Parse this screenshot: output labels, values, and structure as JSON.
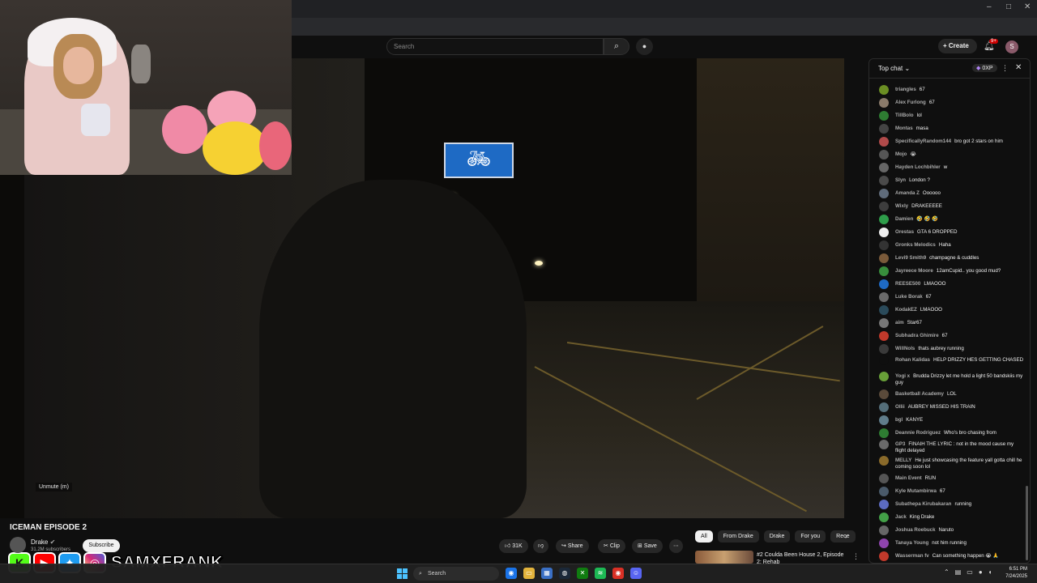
{
  "masthead": {
    "search_placeholder": "Search",
    "create_label": "Create",
    "notifications_badge": "9+",
    "profile_initial": "S"
  },
  "video": {
    "unmute_label": "Unmute (m)",
    "title": "ICEMAN EPISODE 2",
    "channel": "Drake",
    "subscribers": "31.2M subscribers",
    "subscribe_label": "Subscribe",
    "likes": "31K",
    "share_label": "Share",
    "clip_label": "Clip",
    "save_label": "Save"
  },
  "overlay": {
    "social_handle": "SAMXFRANK",
    "social_icons": [
      "kick-icon",
      "youtube-icon",
      "twitter-icon",
      "instagram-icon"
    ]
  },
  "recommendations": {
    "chips": [
      "All",
      "From Drake",
      "Drake",
      "For you",
      "Rece"
    ],
    "active_chip": "All",
    "first_title": "Coulda Been House 2, Episode 2: Rehab",
    "first_index": "#2"
  },
  "chat": {
    "mode": "Top chat",
    "xp": "0XP",
    "messages": [
      {
        "author": "triangles",
        "text": "67",
        "color": "#6b8e23"
      },
      {
        "author": "Alex Furlong",
        "text": "67",
        "color": "#8a7a6a"
      },
      {
        "author": "TillBolo",
        "text": "lol",
        "color": "#2e7d32"
      },
      {
        "author": "Montas",
        "text": "masa",
        "color": "#444444"
      },
      {
        "author": "SpecificallyRandom144",
        "text": "bro got 2 stars on him",
        "color": "#b04a4a"
      },
      {
        "author": "Mojo",
        "text": "😭",
        "color": "#555555"
      },
      {
        "author": "Hayden Lochbihler",
        "text": "w",
        "color": "#666666"
      },
      {
        "author": "Slyn",
        "text": "London ?",
        "color": "#4a4a4a"
      },
      {
        "author": "Amanda Z",
        "text": "Oooooo",
        "color": "#5f6b7a"
      },
      {
        "author": "Wixly",
        "text": "DRAKEEEEE",
        "color": "#3d3d3d"
      },
      {
        "author": "Damien",
        "text": "🤣 🤣 🤣",
        "color": "#2e9d4a"
      },
      {
        "author": "Orestas",
        "text": "GTA 6 DROPPED",
        "color": "#eeeeee"
      },
      {
        "author": "Gronks Melodics",
        "text": "Haha",
        "color": "#333333"
      },
      {
        "author": "Levi9 Smith9",
        "text": "champagne & cuddles",
        "color": "#7a5a3a"
      },
      {
        "author": "Jayreece Moore",
        "text": "12amCupid.. you good mud?",
        "color": "#388e3c"
      },
      {
        "author": "REESE500",
        "text": "LMAOOO",
        "color": "#1e6ac4"
      },
      {
        "author": "Luke Borak",
        "text": "67",
        "color": "#6a6a6a"
      },
      {
        "author": "KodakEZ",
        "text": "LMAOOO",
        "color": "#2a4a5a"
      },
      {
        "author": "aim",
        "text": "Star67",
        "color": "#777777"
      },
      {
        "author": "Subhadra Ghimire",
        "text": "67",
        "color": "#c0392b"
      },
      {
        "author": "WillNoIs",
        "text": "thats aubrey running",
        "color": "#3a3a3a"
      },
      {
        "author": "Rohan Kalidas",
        "text": "HELP DRIZZY HES GETTING CHASED",
        "color": "#0f0f0f"
      },
      {
        "author": "Yogi x",
        "text": "Brudda Drizzy let me hold a light 50 bandskiis my guy",
        "color": "#689f38"
      },
      {
        "author": "Basketball Academy",
        "text": "LOL",
        "color": "#5a4a3a"
      },
      {
        "author": "Ollii",
        "text": "AUBREY MISSED HIS TRAIN",
        "color": "#546e7a"
      },
      {
        "author": "bgl",
        "text": "KANYE",
        "color": "#607d8b"
      },
      {
        "author": "Deannie Rodriguez",
        "text": "Who's bro chasing from",
        "color": "#2e7d32"
      },
      {
        "author": "GP3",
        "text": "FINAIH THE LYRIC : not in the mood cause my flight delayed",
        "color": "#6a6a6a"
      },
      {
        "author": "MELLY",
        "text": "He just showcasing the feature yall gotta chill he coming soon lol",
        "color": "#8a6a2a"
      },
      {
        "author": "Main Event",
        "text": "RUN",
        "color": "#555555"
      },
      {
        "author": "Kyle Mutambirwa",
        "text": "67",
        "color": "#4a5a6a"
      },
      {
        "author": "Subathepa Kirubakaran",
        "text": "running",
        "color": "#5c6bc0"
      },
      {
        "author": "Jack",
        "text": "King Drake",
        "color": "#43a047"
      },
      {
        "author": "Joshua Roebuck",
        "text": "Naruto",
        "color": "#666666"
      },
      {
        "author": "Tanaya Young",
        "text": "not him running",
        "color": "#8e44ad"
      },
      {
        "author": "Wasserman fv",
        "text": "Can something happen 😭 🙏",
        "color": "#c0392b"
      }
    ]
  },
  "taskbar": {
    "search_placeholder": "Search",
    "time": "6:51 PM",
    "date": "7/24/2025",
    "apps": [
      "edge-icon",
      "chrome-icon",
      "folder-icon",
      "store-icon",
      "steam-icon",
      "xbox-icon",
      "spotify-icon",
      "chrome-alt-icon",
      "discord-icon"
    ]
  }
}
